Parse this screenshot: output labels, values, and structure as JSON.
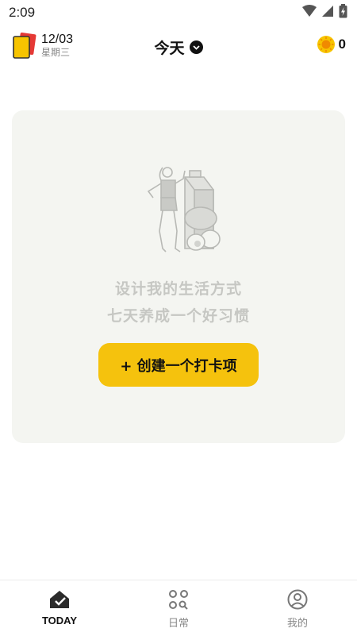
{
  "status_bar": {
    "time": "2:09"
  },
  "header": {
    "date": "12/03",
    "weekday": "星期三",
    "title": "今天",
    "coins": "0"
  },
  "empty_state": {
    "line1": "设计我的生活方式",
    "line2": "七天养成一个好习惯",
    "create_button": "+ 创建一个打卡项"
  },
  "tabs": [
    {
      "label": "TODAY",
      "icon": "home-check-icon",
      "active": true
    },
    {
      "label": "日常",
      "icon": "grid-search-icon",
      "active": false
    },
    {
      "label": "我的",
      "icon": "user-circle-icon",
      "active": false
    }
  ],
  "colors": {
    "accent": "#f5c20d",
    "card_bg": "#f4f5f1",
    "muted_text": "#c6c7c3"
  }
}
